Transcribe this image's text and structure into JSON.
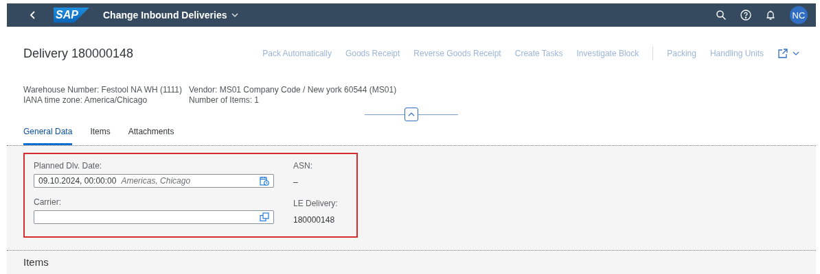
{
  "shell": {
    "logo": "SAP",
    "title": "Change Inbound Deliveries",
    "avatar": "NC"
  },
  "header": {
    "title": "Delivery 180000148",
    "action_groups": [
      [
        {
          "label": "Pack Automatically",
          "disabled": true
        },
        {
          "label": "Goods Receipt",
          "disabled": true
        },
        {
          "label": "Reverse Goods Receipt",
          "disabled": true
        },
        {
          "label": "Create Tasks",
          "disabled": true
        },
        {
          "label": "Investigate Block",
          "disabled": true
        }
      ],
      [
        {
          "label": "Packing",
          "disabled": true
        },
        {
          "label": "Handling Units",
          "disabled": true
        }
      ]
    ],
    "attributes": [
      [
        "Warehouse Number: Festool NA WH (1111)",
        "IANA time zone: America/Chicago"
      ],
      [
        "Vendor: MS01 Company Code / New york 60544 (MS01)",
        "Number of Items: 1"
      ]
    ]
  },
  "tabs": [
    {
      "label": "General Data",
      "selected": true
    },
    {
      "label": "Items",
      "selected": false
    },
    {
      "label": "Attachments",
      "selected": false
    }
  ],
  "general_data": {
    "highlighted": true,
    "fields": [
      {
        "label": "Planned Dlv. Date:",
        "value": "09.10.2024, 00:00:00",
        "timezone": "Americas, Chicago",
        "kind": "datetime"
      },
      {
        "label": "Carrier:",
        "kind": "valuehelp"
      }
    ],
    "displays": [
      {
        "label": "ASN:",
        "value": "–"
      },
      {
        "label": "LE Delivery:",
        "value": "180000148"
      }
    ]
  },
  "sections": [
    {
      "title": "Items"
    }
  ]
}
